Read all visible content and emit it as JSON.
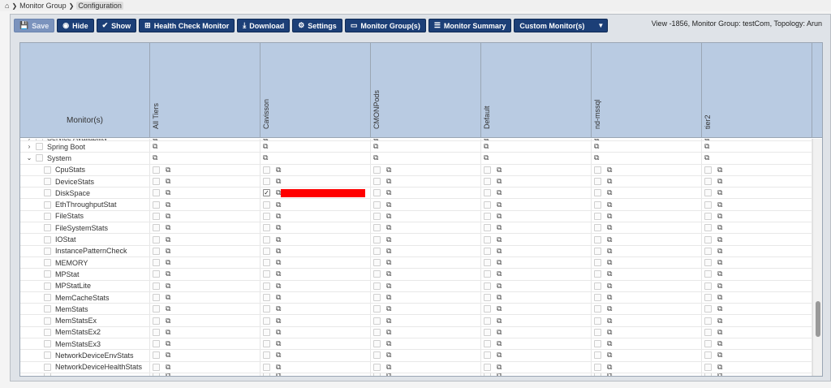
{
  "breadcrumb": {
    "items": [
      "Monitor Group",
      "Configuration"
    ]
  },
  "toolbar": {
    "save": "Save",
    "hide": "Hide",
    "show": "Show",
    "health_check": "Health Check Monitor",
    "download": "Download",
    "settings": "Settings",
    "monitor_groups": "Monitor Group(s)",
    "monitor_summary": "Monitor Summary",
    "custom_monitors": "Custom Monitor(s)"
  },
  "view_info": "View -1856, Monitor Group: testCom, Topology: Arun",
  "table": {
    "monitor_header": "Monitor(s)",
    "columns": [
      "All Tiers",
      "Cavisson",
      "CMONPods",
      "Default",
      "nd-mssql",
      "tier2"
    ],
    "rows": [
      {
        "name": "Service Availability",
        "level": 1,
        "partial": true
      },
      {
        "name": "Spring Boot",
        "level": 1,
        "expand": "›"
      },
      {
        "name": "System",
        "level": 1,
        "expand": "⌄"
      },
      {
        "name": "CpuStats",
        "level": 2
      },
      {
        "name": "DeviceStats",
        "level": 2
      },
      {
        "name": "DiskSpace",
        "level": 2,
        "checked_col": 1,
        "red_col": 1
      },
      {
        "name": "EthThroughputStat",
        "level": 2
      },
      {
        "name": "FileStats",
        "level": 2
      },
      {
        "name": "FileSystemStats",
        "level": 2
      },
      {
        "name": "IOStat",
        "level": 2
      },
      {
        "name": "InstancePatternCheck",
        "level": 2
      },
      {
        "name": "MEMORY",
        "level": 2
      },
      {
        "name": "MPStat",
        "level": 2
      },
      {
        "name": "MPStatLite",
        "level": 2
      },
      {
        "name": "MemCacheStats",
        "level": 2
      },
      {
        "name": "MemStats",
        "level": 2
      },
      {
        "name": "MemStatsEx",
        "level": 2
      },
      {
        "name": "MemStatsEx2",
        "level": 2
      },
      {
        "name": "MemStatsEx3",
        "level": 2
      },
      {
        "name": "NetworkDeviceEnvStats",
        "level": 2
      },
      {
        "name": "NetworkDeviceHealthStats",
        "level": 2
      },
      {
        "name": "",
        "level": 2,
        "partial": true
      }
    ]
  },
  "colors": {
    "button": "#1c3f77",
    "header": "#b9cbe2",
    "highlight": "#ff0000"
  },
  "icons": {
    "external_link": "external-link-icon",
    "checkmark": "check-icon"
  }
}
